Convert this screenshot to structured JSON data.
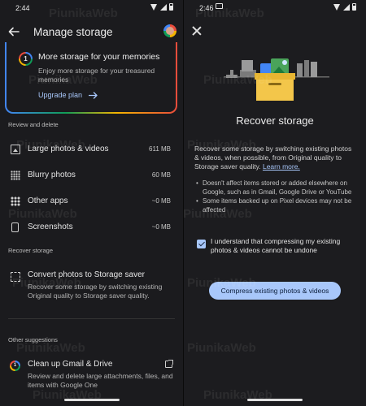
{
  "left": {
    "status": {
      "time": "2:44"
    },
    "app_bar": {
      "title": "Manage storage"
    },
    "promo": {
      "title": "More storage for your memories",
      "description": "Enjoy more storage for your treasured memories",
      "link": "Upgrade plan"
    },
    "review_section": {
      "label": "Review and delete",
      "items": [
        {
          "label": "Large photos & videos",
          "value": "611 MB",
          "icon": "photo-icon"
        },
        {
          "label": "Blurry photos",
          "value": "60 MB",
          "icon": "blur-icon"
        },
        {
          "label": "Other apps",
          "value": "~0 MB",
          "icon": "apps-grid-icon"
        },
        {
          "label": "Screenshots",
          "value": "~0 MB",
          "icon": "screenshot-icon"
        }
      ]
    },
    "recover_section": {
      "label": "Recover storage",
      "item_title": "Convert photos to Storage saver",
      "item_desc": "Recover some storage by switching existing Original quality to Storage saver quality."
    },
    "other_section": {
      "label": "Other suggestions",
      "item_title": "Clean up Gmail & Drive",
      "item_desc": "Review and delete large attachments, files, and items with Google One"
    }
  },
  "right": {
    "status": {
      "time": "2:46"
    },
    "title": "Recover storage",
    "description": "Recover some storage by switching existing photos & videos, when possible, from Original quality to Storage saver quality.",
    "learn_more": "Learn more.",
    "bullets": [
      "Doesn't affect items stored or added elsewhere on Google, such as in Gmail, Google Drive or YouTube",
      "Some items backed up on Pixel devices may not be affected"
    ],
    "checkbox_label": "I understand that compressing my existing photos & videos cannot be undone",
    "checkbox_checked": true,
    "button_label": "Compress existing photos & videos"
  },
  "watermark": "PiunikaWeb",
  "colors": {
    "accent": "#a8c7fa",
    "background": "#1b1b1e"
  }
}
